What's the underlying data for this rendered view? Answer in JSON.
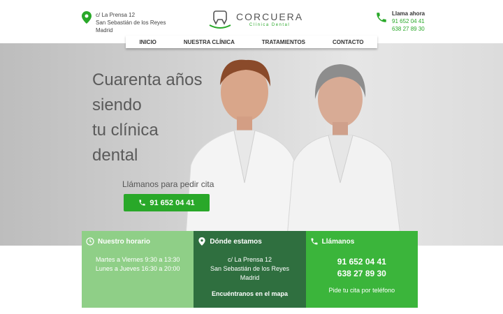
{
  "header": {
    "address_lines": [
      "c/ La Prensa 12",
      "San Sebastián de los Reyes",
      "Madrid"
    ],
    "logo_name": "CORCUERA",
    "logo_sub": "Clínica Dental",
    "call_label": "Llama ahora",
    "phones": [
      "91 652 04 41",
      "638 27 89 30"
    ]
  },
  "nav": [
    "INICIO",
    "NUESTRA CLÍNICA",
    "TRATAMIENTOS",
    "CONTACTO"
  ],
  "hero": {
    "headline_lines": [
      "Cuarenta años",
      "siendo",
      "tu clínica",
      "dental"
    ],
    "call_prompt": "Llámanos para pedir cita",
    "call_button": "91 652 04 41"
  },
  "boxes": {
    "hours": {
      "title": "Nuestro horario",
      "lines": [
        "Martes a Viernes 9:30 a 13:30",
        "Lunes a Jueves 16:30 a 20:00"
      ]
    },
    "location": {
      "title": "Dónde estamos",
      "lines": [
        "c/ La Prensa 12",
        "San Sebastián de los Reyes",
        "Madrid"
      ],
      "map_link": "Encuéntranos en el mapa"
    },
    "call": {
      "title": "Llámanos",
      "phones": [
        "91 652 04 41",
        "638 27 89 30"
      ],
      "cta": "Pide tu cita por teléfono"
    }
  },
  "colors": {
    "accent": "#29a829",
    "box_light": "#8fcf87",
    "box_dark": "#2f6f3f",
    "box_bright": "#3bb53b"
  },
  "icons": [
    "map-pin-icon",
    "phone-icon",
    "clock-icon",
    "tooth-logo-icon"
  ]
}
